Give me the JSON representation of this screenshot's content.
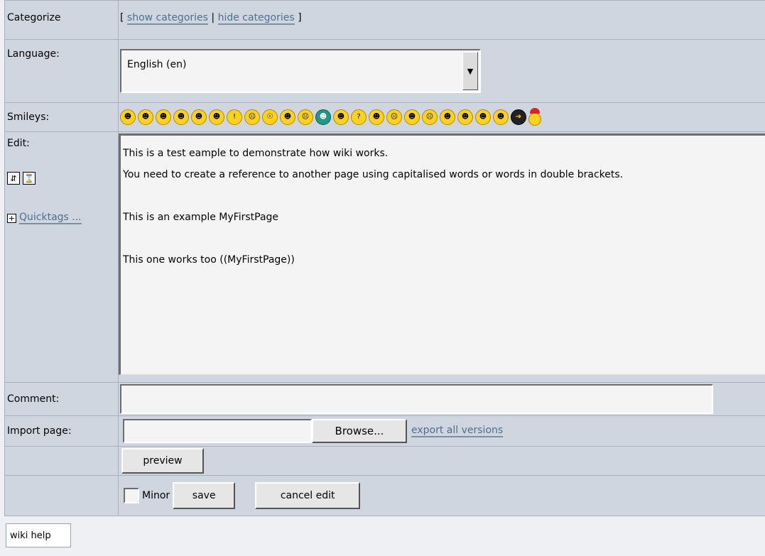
{
  "categorize": {
    "label": "Categorize",
    "bracket_open": "[",
    "show": "show categories",
    "separator": "|",
    "hide": "hide categories",
    "bracket_close": "]"
  },
  "language": {
    "label": "Language:",
    "selected": "English (en)"
  },
  "smileys": {
    "label": "Smileys:",
    "items": [
      "biggrin",
      "confused",
      "cool",
      "cry",
      "eek",
      "evil",
      "exclaim",
      "frown",
      "idea",
      "lol",
      "mad",
      "mrgreen",
      "neutral",
      "question",
      "razz",
      "redface",
      "rolleyes",
      "sad",
      "smile",
      "surprised",
      "twisted",
      "wink",
      "arrow",
      "santa"
    ]
  },
  "edit": {
    "label": "Edit:",
    "quicktags": "Quicktags ...",
    "content": "This is a test eample to demonstrate how wiki works.\nYou need to create a reference to another page using capitalised words or words in double brackets.\n\nThis is an example MyFirstPage\n\nThis one works too ((MyFirstPage))"
  },
  "comment": {
    "label": "Comment:",
    "value": ""
  },
  "import": {
    "label": "Import page:",
    "browse": "Browse...",
    "export": "export all versions"
  },
  "buttons": {
    "preview": "preview",
    "minor": "Minor",
    "save": "save",
    "cancel": "cancel edit"
  },
  "footer": {
    "help": "wiki help"
  }
}
